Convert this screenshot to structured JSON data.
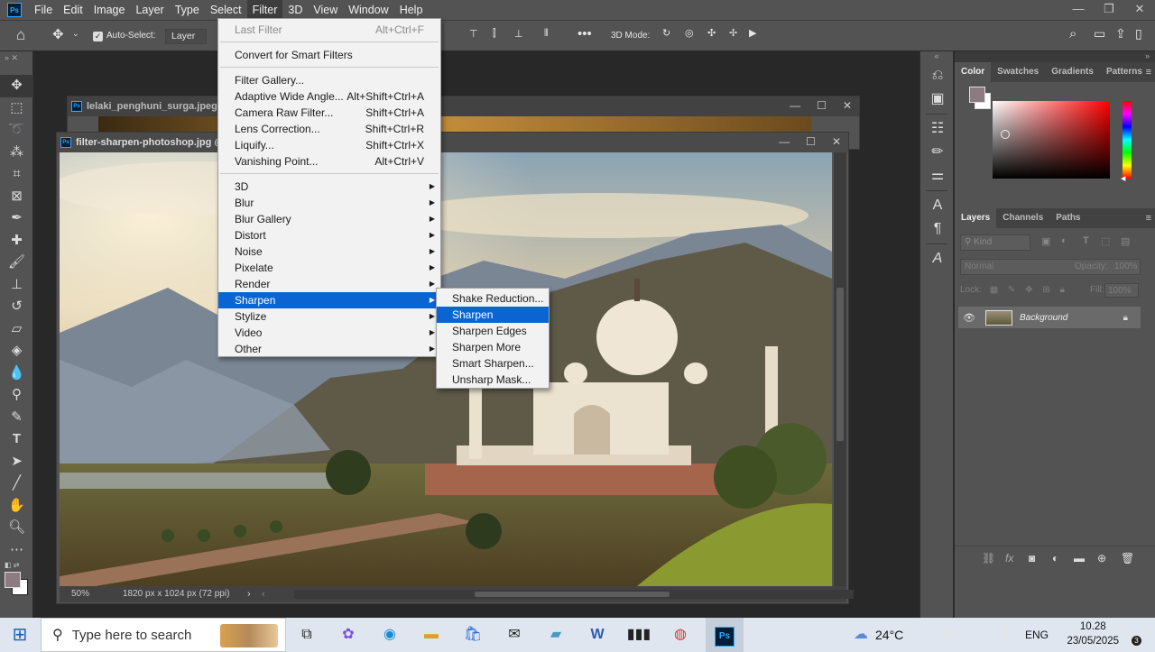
{
  "menubar": {
    "logo": "Ps",
    "items": [
      "File",
      "Edit",
      "Image",
      "Layer",
      "Type",
      "Select",
      "Filter",
      "3D",
      "View",
      "Window",
      "Help"
    ],
    "active": "Filter"
  },
  "options_bar": {
    "auto_select_label": "Auto-Select:",
    "auto_select_value": "Layer",
    "mode_label": "3D Mode:"
  },
  "documents": {
    "back_title": "lelaki_penghuni_surga.jpeg @",
    "front_title": "filter-sharpen-photoshop.jpg @",
    "zoom": "50%",
    "dimensions": "1820 px x 1024 px (72 ppi)"
  },
  "filter_menu": {
    "last_filter": {
      "label": "Last Filter",
      "shortcut": "Alt+Ctrl+F"
    },
    "convert": "Convert for Smart Filters",
    "group1": [
      {
        "label": "Filter Gallery...",
        "shortcut": ""
      },
      {
        "label": "Adaptive Wide Angle...",
        "shortcut": "Alt+Shift+Ctrl+A"
      },
      {
        "label": "Camera Raw Filter...",
        "shortcut": "Shift+Ctrl+A"
      },
      {
        "label": "Lens Correction...",
        "shortcut": "Shift+Ctrl+R"
      },
      {
        "label": "Liquify...",
        "shortcut": "Shift+Ctrl+X"
      },
      {
        "label": "Vanishing Point...",
        "shortcut": "Alt+Ctrl+V"
      }
    ],
    "submenus": [
      "3D",
      "Blur",
      "Blur Gallery",
      "Distort",
      "Noise",
      "Pixelate",
      "Render",
      "Sharpen",
      "Stylize",
      "Video",
      "Other"
    ],
    "highlighted": "Sharpen"
  },
  "sharpen_menu": {
    "items": [
      "Shake Reduction...",
      "Sharpen",
      "Sharpen Edges",
      "Sharpen More",
      "Smart Sharpen...",
      "Unsharp Mask..."
    ],
    "highlighted": "Sharpen"
  },
  "color_panel": {
    "tabs": [
      "Color",
      "Swatches",
      "Gradients",
      "Patterns"
    ],
    "active": "Color",
    "foreground": "#8c7b80",
    "background": "#ffffff"
  },
  "layers_panel": {
    "tabs": [
      "Layers",
      "Channels",
      "Paths"
    ],
    "active": "Layers",
    "filter_placeholder": "Kind",
    "blend_mode": "Normal",
    "opacity_label": "Opacity:",
    "opacity_value": "100%",
    "lock_label": "Lock:",
    "fill_label": "Fill:",
    "fill_value": "100%",
    "layers": [
      {
        "name": "Background",
        "locked": true,
        "visible": true
      }
    ]
  },
  "taskbar": {
    "search_placeholder": "Type here to search",
    "weather": "24°C",
    "language": "ENG",
    "time": "10.28",
    "date": "23/05/2025",
    "notifications": "3"
  }
}
